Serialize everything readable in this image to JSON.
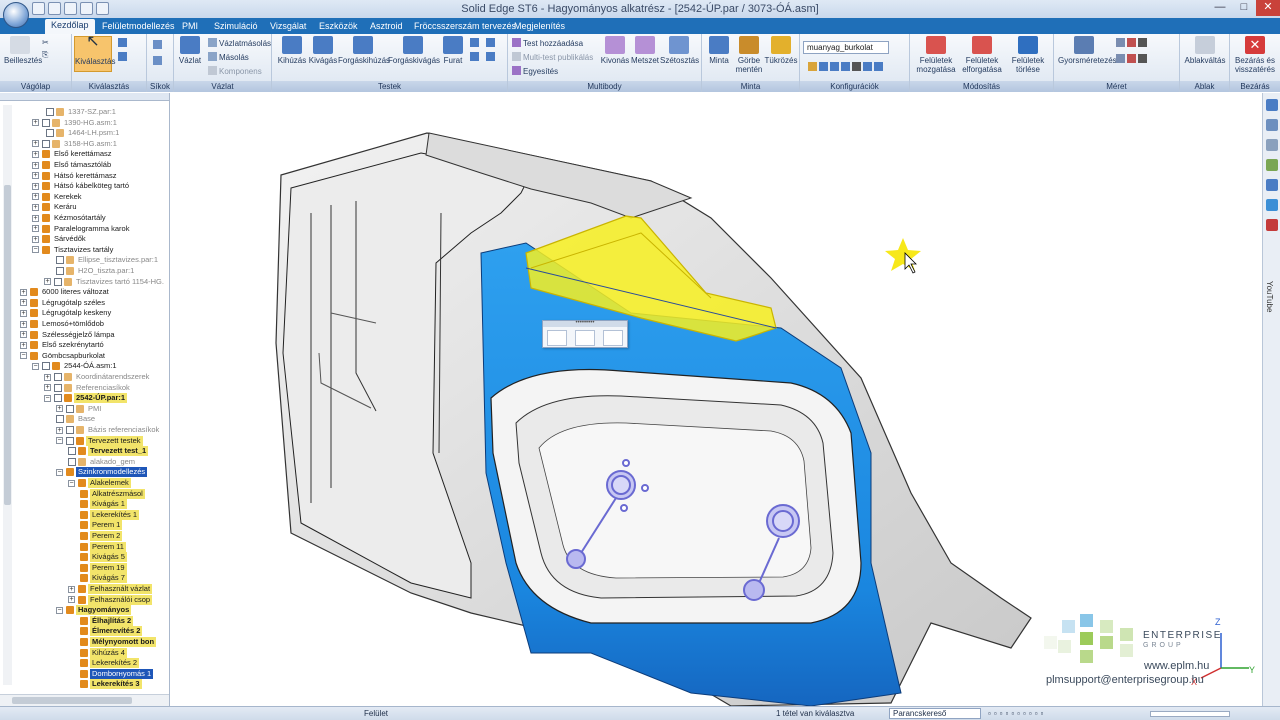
{
  "window": {
    "title": "Solid Edge ST6 - Hagyományos alkatrész - [2542-ÚP.par / 3073-ÓÁ.asm]",
    "minimize": "—",
    "maximize": "□",
    "close": "✕"
  },
  "tabs": [
    "Kezdőlap",
    "Felületmodellezés",
    "PMI",
    "Szimuláció",
    "Vizsgálat",
    "Eszközök",
    "Asztroid",
    "Fröccsszerszám tervezés",
    "Megjelenítés"
  ],
  "ribbon": {
    "groups": {
      "vagolap": "Vágólap",
      "kivalasztas": "Kiválasztás",
      "sikok": "Síkok",
      "vazlat": "Vázlat",
      "testek": "Testek",
      "multibody": "Multibody",
      "minta": "Minta",
      "konfiguraciok": "Konfigurációk",
      "modositas": "Módosítás",
      "meret": "Méret",
      "ablak": "Ablak",
      "bezaras": "Bezárás"
    },
    "buttons": {
      "beillesztes": "Beillesztés",
      "kivalasztas": "Kiválasztás",
      "vazlat": "Vázlat",
      "vazlatmasolas": "Vázlatmásolás",
      "masolas": "Másolás",
      "komponens": "Komponens",
      "kihuzas": "Kihúzás",
      "kivagas": "Kivágás",
      "forgaskihuzas": "Forgáskihúzás",
      "forgaskivagas": "Forgáskivágás",
      "furat": "Furat",
      "test_hozzaadasa": "Test hozzáadása",
      "multi_test": "Multi-test publikálás",
      "egyesites": "Egyesítés",
      "kivonas": "Kivonás",
      "metszet": "Metszet",
      "szetosztas": "Szétosztás",
      "minta": "Minta",
      "gorbe_menten": "Görbe mentén",
      "tukrozes": "Tükrözés",
      "felulet_mozgatasa": "Felületek mozgatása",
      "felulet_elforgatasa": "Felületek elforgatása",
      "felulet_torlese": "Felületek törlése",
      "gyorsmeretezes": "Gyorsméretezés",
      "ablakvaltas": "Ablakváltás",
      "bezaras": "Bezárás és visszatérés"
    },
    "config_value": "muanyag_burkolat"
  },
  "tree": [
    {
      "label": "1337-SZ.par:1",
      "indent": 46,
      "exp": "",
      "chk": true,
      "style": "grey"
    },
    {
      "label": "1390-HG.asm:1",
      "indent": 32,
      "exp": "+",
      "chk": true,
      "style": "grey"
    },
    {
      "label": "1464-LH.psm:1",
      "indent": 46,
      "exp": "",
      "chk": true,
      "style": "grey"
    },
    {
      "label": "3158-HG.asm:1",
      "indent": 32,
      "exp": "+",
      "chk": true,
      "style": "grey"
    },
    {
      "label": "Első kerettámasz",
      "indent": 32,
      "exp": "+",
      "chk": false,
      "style": ""
    },
    {
      "label": "Első támasztóláb",
      "indent": 32,
      "exp": "+",
      "chk": false,
      "style": ""
    },
    {
      "label": "Hátsó kerettámasz",
      "indent": 32,
      "exp": "+",
      "chk": false,
      "style": ""
    },
    {
      "label": "Hátsó kábelköteg tartó",
      "indent": 32,
      "exp": "+",
      "chk": false,
      "style": ""
    },
    {
      "label": "Kerekek",
      "indent": 32,
      "exp": "+",
      "chk": false,
      "style": ""
    },
    {
      "label": "Keráru",
      "indent": 32,
      "exp": "+",
      "chk": false,
      "style": ""
    },
    {
      "label": "Kézmosótartály",
      "indent": 32,
      "exp": "+",
      "chk": false,
      "style": ""
    },
    {
      "label": "Paralelogramma karok",
      "indent": 32,
      "exp": "+",
      "chk": false,
      "style": ""
    },
    {
      "label": "Sárvédők",
      "indent": 32,
      "exp": "+",
      "chk": false,
      "style": ""
    },
    {
      "label": "Tisztavizes tartály",
      "indent": 32,
      "exp": "−",
      "chk": false,
      "style": ""
    },
    {
      "label": "Ellipse_tisztavizes.par:1",
      "indent": 56,
      "exp": "",
      "chk": true,
      "style": "grey"
    },
    {
      "label": "H2O_tiszta.par:1",
      "indent": 56,
      "exp": "",
      "chk": true,
      "style": "grey"
    },
    {
      "label": "Tisztavizes tartó 1154-HG.",
      "indent": 44,
      "exp": "+",
      "chk": true,
      "style": "grey"
    },
    {
      "label": "6000 literes változat",
      "indent": 20,
      "exp": "+",
      "chk": false,
      "style": ""
    },
    {
      "label": "Légrugótalp széles",
      "indent": 20,
      "exp": "+",
      "chk": false,
      "style": ""
    },
    {
      "label": "Légrugótalp keskeny",
      "indent": 20,
      "exp": "+",
      "chk": false,
      "style": ""
    },
    {
      "label": "Lemosó+tömlődob",
      "indent": 20,
      "exp": "+",
      "chk": false,
      "style": ""
    },
    {
      "label": "Szélességjelző lámpa",
      "indent": 20,
      "exp": "+",
      "chk": false,
      "style": ""
    },
    {
      "label": "Első szekrénytartó",
      "indent": 20,
      "exp": "+",
      "chk": false,
      "style": ""
    },
    {
      "label": "Gömbcsapburkolat",
      "indent": 20,
      "exp": "−",
      "chk": false,
      "style": ""
    },
    {
      "label": "2544-ÓÁ.asm:1",
      "indent": 32,
      "exp": "−",
      "chk": true,
      "style": ""
    },
    {
      "label": "Koordinátarendszerek",
      "indent": 44,
      "exp": "+",
      "chk": true,
      "style": "grey"
    },
    {
      "label": "Referenciasíkok",
      "indent": 44,
      "exp": "+",
      "chk": true,
      "style": "grey"
    },
    {
      "label": "2542-ÚP.par:1",
      "indent": 44,
      "exp": "−",
      "chk": true,
      "style": "hl bold"
    },
    {
      "label": "PMI",
      "indent": 56,
      "exp": "+",
      "chk": true,
      "style": "grey"
    },
    {
      "label": "Base",
      "indent": 56,
      "exp": "",
      "chk": true,
      "style": "grey"
    },
    {
      "label": "Bázis referenciasíkok",
      "indent": 56,
      "exp": "+",
      "chk": true,
      "style": "grey"
    },
    {
      "label": "Tervezett testek",
      "indent": 56,
      "exp": "−",
      "chk": true,
      "style": "hl"
    },
    {
      "label": "Tervezett test_1",
      "indent": 68,
      "exp": "",
      "chk": true,
      "style": "hl bold"
    },
    {
      "label": "alakado_gem",
      "indent": 68,
      "exp": "",
      "chk": true,
      "style": "grey"
    },
    {
      "label": "Szinkronmodellezés",
      "indent": 56,
      "exp": "−",
      "chk": false,
      "style": "sel"
    },
    {
      "label": "Alakelemek",
      "indent": 68,
      "exp": "−",
      "chk": false,
      "style": "hl"
    },
    {
      "label": "Alkatrészmásol",
      "indent": 80,
      "exp": "",
      "chk": false,
      "style": "hl"
    },
    {
      "label": "Kivágás 1",
      "indent": 80,
      "exp": "",
      "chk": false,
      "style": "hl"
    },
    {
      "label": "Lekerekítés 1",
      "indent": 80,
      "exp": "",
      "chk": false,
      "style": "hl"
    },
    {
      "label": "Perem 1",
      "indent": 80,
      "exp": "",
      "chk": false,
      "style": "hl"
    },
    {
      "label": "Perem 2",
      "indent": 80,
      "exp": "",
      "chk": false,
      "style": "hl"
    },
    {
      "label": "Perem 11",
      "indent": 80,
      "exp": "",
      "chk": false,
      "style": "hl"
    },
    {
      "label": "Kivágás 5",
      "indent": 80,
      "exp": "",
      "chk": false,
      "style": "hl"
    },
    {
      "label": "Perem 19",
      "indent": 80,
      "exp": "",
      "chk": false,
      "style": "hl"
    },
    {
      "label": "Kivágás 7",
      "indent": 80,
      "exp": "",
      "chk": false,
      "style": "hl"
    },
    {
      "label": "Felhasznált vázlat",
      "indent": 68,
      "exp": "+",
      "chk": false,
      "style": "hl"
    },
    {
      "label": "Felhasználói csop",
      "indent": 68,
      "exp": "+",
      "chk": false,
      "style": "hl"
    },
    {
      "label": "Hagyományos",
      "indent": 56,
      "exp": "−",
      "chk": false,
      "style": "hl bold"
    },
    {
      "label": "Élhajlítás 2",
      "indent": 80,
      "exp": "",
      "chk": false,
      "style": "hl bold"
    },
    {
      "label": "Élmerevítés 2",
      "indent": 80,
      "exp": "",
      "chk": false,
      "style": "hl bold"
    },
    {
      "label": "Mélynyomott bon",
      "indent": 80,
      "exp": "",
      "chk": false,
      "style": "hl bold"
    },
    {
      "label": "Kihúzás 4",
      "indent": 80,
      "exp": "",
      "chk": false,
      "style": "hl"
    },
    {
      "label": "Lekerekítés 2",
      "indent": 80,
      "exp": "",
      "chk": false,
      "style": "hl"
    },
    {
      "label": "Domborнyomás 1",
      "indent": 80,
      "exp": "",
      "chk": false,
      "style": "sel"
    },
    {
      "label": "Lekerekítés 3",
      "indent": 80,
      "exp": "",
      "chk": false,
      "style": "hl bold"
    }
  ],
  "status": {
    "left": "Felület",
    "selection": "1 tétel van kiválasztva",
    "command_search_placeholder": "Parancskereső"
  },
  "sidebar_right": {
    "youtube": "YouTube"
  },
  "logo": {
    "brand": "ENTERPRISE",
    "group": "GROUP",
    "url": "www.eplm.hu",
    "mail": "plmsupport@enterprisegroup.hu"
  },
  "triad": {
    "z": "Z",
    "x": "X",
    "y": "Y"
  },
  "colors": {
    "ribbon_blue": "#1f6fb8",
    "surface_blue": "#1f8fe0",
    "highlight_yellow": "#f7f020",
    "selection_blue": "#1e56b8"
  }
}
